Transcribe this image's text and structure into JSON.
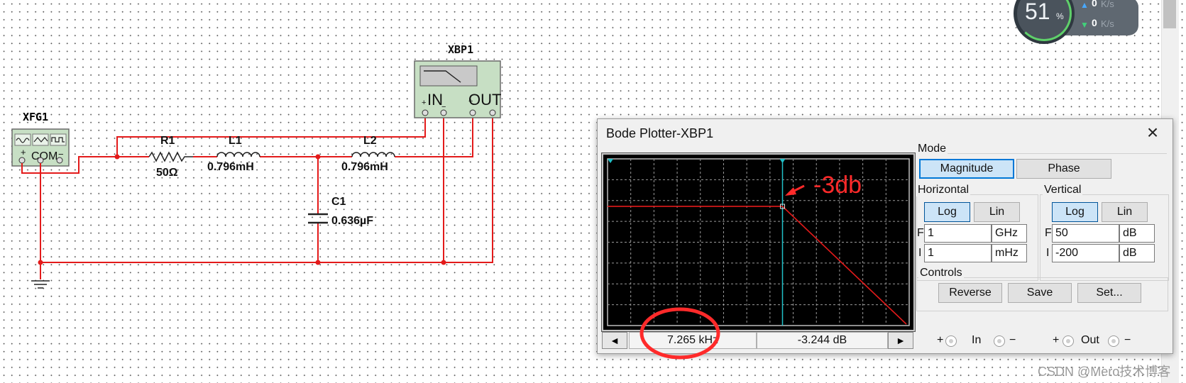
{
  "schematic": {
    "function_generator": {
      "name": "XFG1",
      "com_label": "COM"
    },
    "plotter_instrument": {
      "name": "XBP1",
      "in_label": "IN",
      "out_label": "OUT"
    },
    "components": {
      "R1": {
        "name": "R1",
        "value": "50Ω"
      },
      "L1": {
        "name": "L1",
        "value": "0.796mH"
      },
      "L2": {
        "name": "L2",
        "value": "0.796mH"
      },
      "C1": {
        "name": "C1",
        "value": "0.636µF"
      }
    },
    "wire_color": "#e31a1a"
  },
  "bode": {
    "title": "Bode Plotter-XBP1",
    "close_icon": "×",
    "annotation": "-3db",
    "readout_freq": "7.265 kHz",
    "readout_db": "-3.244 dB",
    "left_arrow": "◄",
    "right_arrow": "►",
    "trace": {
      "cutoff_fraction": 0.58,
      "level_fraction": 0.285
    },
    "mode": {
      "label": "Mode",
      "magnitude": "Magnitude",
      "phase": "Phase"
    },
    "horizontal": {
      "label": "Horizontal",
      "log": "Log",
      "lin": "Lin",
      "f_label": "F",
      "f_value": "1",
      "f_unit": "GHz",
      "i_label": "I",
      "i_value": "1",
      "i_unit": "mHz"
    },
    "vertical": {
      "label": "Vertical",
      "log": "Log",
      "lin": "Lin",
      "f_label": "F",
      "f_value": "50",
      "f_unit": "dB",
      "i_label": "I",
      "i_value": "-200",
      "i_unit": "dB"
    },
    "controls": {
      "label": "Controls",
      "reverse": "Reverse",
      "save": "Save",
      "set": "Set..."
    },
    "terminals": {
      "in_plus": "+",
      "in_label": "In",
      "in_minus": "−",
      "out_plus": "+",
      "out_label": "Out",
      "out_minus": "−"
    }
  },
  "speed_widget": {
    "percent": "51",
    "percent_sign": "%",
    "upload": "0",
    "upload_unit": "K/s",
    "download": "0",
    "download_unit": "K/s"
  },
  "watermark": "CSDN @Mero技术博客"
}
